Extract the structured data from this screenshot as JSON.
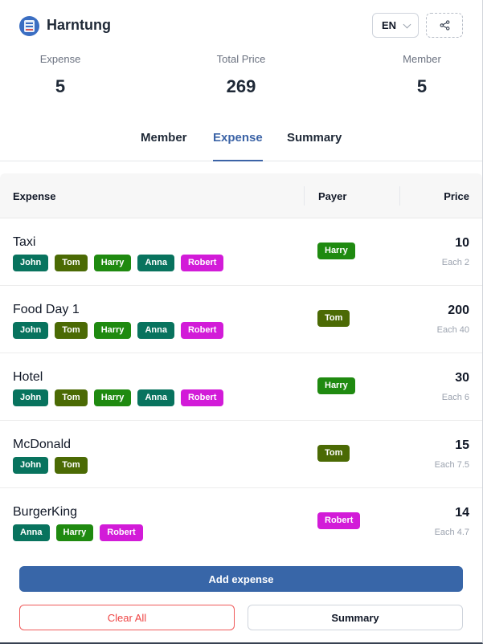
{
  "app": {
    "title": "Harntung",
    "language": "EN"
  },
  "stats": [
    {
      "label": "Expense",
      "value": "5"
    },
    {
      "label": "Total Price",
      "value": "269"
    },
    {
      "label": "Member",
      "value": "5"
    }
  ],
  "tabs": [
    {
      "label": "Member",
      "active": false
    },
    {
      "label": "Expense",
      "active": true
    },
    {
      "label": "Summary",
      "active": false
    }
  ],
  "table": {
    "headers": {
      "expense": "Expense",
      "payer": "Payer",
      "price": "Price"
    },
    "rows": [
      {
        "name": "Taxi",
        "members": [
          "John",
          "Tom",
          "Harry",
          "Anna",
          "Robert"
        ],
        "payer": "Harry",
        "price": "10",
        "each": "Each 2"
      },
      {
        "name": "Food Day 1",
        "members": [
          "John",
          "Tom",
          "Harry",
          "Anna",
          "Robert"
        ],
        "payer": "Tom",
        "price": "200",
        "each": "Each 40"
      },
      {
        "name": "Hotel",
        "members": [
          "John",
          "Tom",
          "Harry",
          "Anna",
          "Robert"
        ],
        "payer": "Harry",
        "price": "30",
        "each": "Each 6"
      },
      {
        "name": "McDonald",
        "members": [
          "John",
          "Tom"
        ],
        "payer": "Tom",
        "price": "15",
        "each": "Each 7.5"
      },
      {
        "name": "BurgerKing",
        "members": [
          "Anna",
          "Harry",
          "Robert"
        ],
        "payer": "Robert",
        "price": "14",
        "each": "Each 4.7"
      }
    ]
  },
  "member_colors": {
    "John": "#08735e",
    "Tom": "#4b6a04",
    "Harry": "#1f8a10",
    "Anna": "#08735e",
    "Robert": "#d21bd8"
  },
  "actions": {
    "add_expense": "Add expense",
    "clear_all": "Clear All",
    "summary": "Summary"
  },
  "icons": {
    "logo": "app-logo-icon",
    "share": "share-icon",
    "chevron": "chevron-down-icon"
  }
}
